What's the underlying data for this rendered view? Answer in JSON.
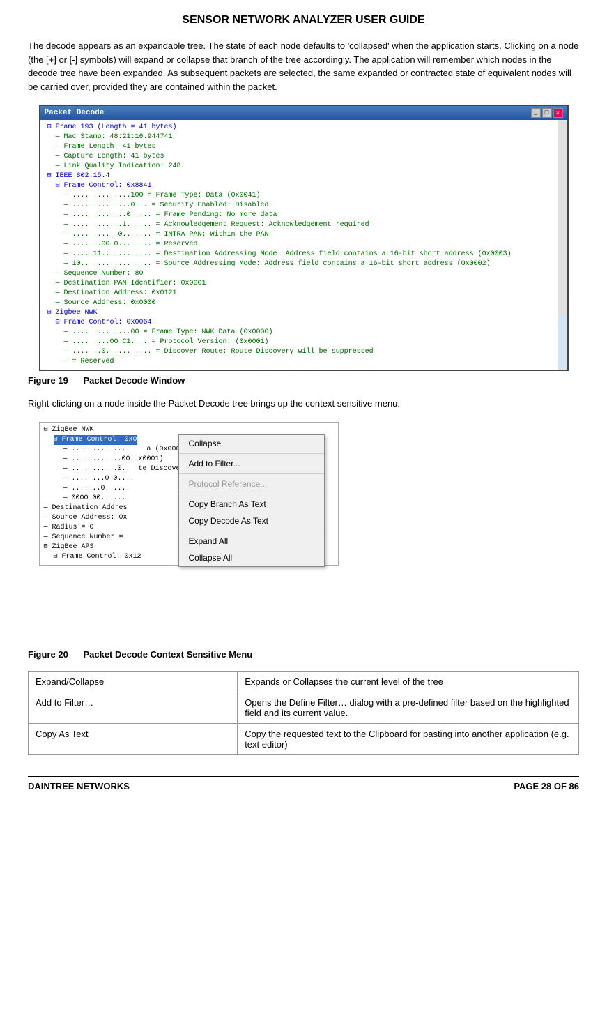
{
  "page": {
    "title": "SENSOR NETWORK ANALYZER USER GUIDE",
    "intro_text": "The decode appears as an expandable tree.  The state of each node defaults to 'collapsed' when the application starts.  Clicking on a node (the [+] or [-] symbols) will expand or collapse that branch of the tree accordingly.  The application will remember which nodes in the decode tree have been expanded. As subsequent packets are selected, the same expanded or contracted state of equivalent nodes will be carried over, provided they are contained within the packet.",
    "figure19_caption_label": "Figure 19",
    "figure19_caption_text": "Packet Decode Window",
    "right_click_text": "Right-clicking on a node inside the Packet Decode tree brings up the context sensitive menu.",
    "figure20_caption_label": "Figure 20",
    "figure20_caption_text": "Packet Decode Context Sensitive Menu",
    "packet_decode_title": "Packet Decode",
    "context_menu": {
      "items": [
        {
          "label": "Collapse",
          "type": "item"
        },
        {
          "label": "Add to Filter...",
          "type": "item"
        },
        {
          "label": "Protocol Reference...",
          "type": "disabled"
        },
        {
          "label": "Copy Branch As Text",
          "type": "item"
        },
        {
          "label": "Copy Decode As Text",
          "type": "item"
        },
        {
          "label": "Expand All",
          "type": "item"
        },
        {
          "label": "Collapse All",
          "type": "item"
        }
      ]
    },
    "table": {
      "rows": [
        {
          "col1": "Expand/Collapse",
          "col2": "Expands or Collapses the current level of the tree"
        },
        {
          "col1": "Add to Filter…",
          "col2": "Opens the Define Filter… dialog with a pre-defined filter based on the highlighted field and its current value."
        },
        {
          "col1": "Copy As Text",
          "col2": "Copy the requested text to the Clipboard for pasting into another application (e.g. text editor)"
        }
      ]
    },
    "footer": {
      "left": "DAINTREE NETWORKS",
      "right": "PAGE 28 OF 86"
    }
  }
}
